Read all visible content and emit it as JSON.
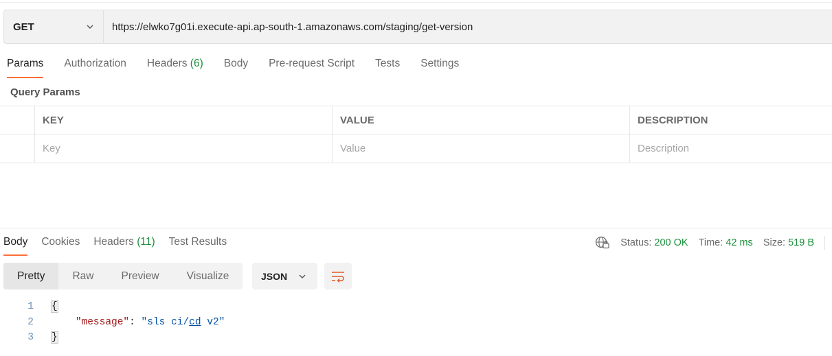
{
  "request": {
    "method": "GET",
    "url": "https://elwko7g01i.execute-api.ap-south-1.amazonaws.com/staging/get-version"
  },
  "request_tabs": [
    {
      "label": "Params",
      "count": ""
    },
    {
      "label": "Authorization",
      "count": ""
    },
    {
      "label": "Headers",
      "count": "(6)"
    },
    {
      "label": "Body",
      "count": ""
    },
    {
      "label": "Pre-request Script",
      "count": ""
    },
    {
      "label": "Tests",
      "count": ""
    },
    {
      "label": "Settings",
      "count": ""
    }
  ],
  "query_params": {
    "title": "Query Params",
    "columns": [
      "KEY",
      "VALUE",
      "DESCRIPTION"
    ],
    "placeholders": {
      "key": "Key",
      "value": "Value",
      "description": "Description"
    }
  },
  "response_tabs": [
    {
      "label": "Body",
      "count": ""
    },
    {
      "label": "Cookies",
      "count": ""
    },
    {
      "label": "Headers",
      "count": "(11)"
    },
    {
      "label": "Test Results",
      "count": ""
    }
  ],
  "status": {
    "status_label": "Status:",
    "status_value": "200 OK",
    "time_label": "Time:",
    "time_value": "42 ms",
    "size_label": "Size:",
    "size_value": "519 B"
  },
  "view_modes": [
    "Pretty",
    "Raw",
    "Preview",
    "Visualize"
  ],
  "format": "JSON",
  "code": {
    "line_numbers": [
      "1",
      "2",
      "3"
    ],
    "open_brace": "{",
    "close_brace": "}",
    "key": "\"message\"",
    "colon": ": ",
    "value_start": "\"sls ci/",
    "value_link": "cd",
    "value_end": " v2\""
  },
  "colors": {
    "accent": "#ff6c37",
    "status_green": "#1c8f3c"
  },
  "icons": [
    "chevron-down-icon",
    "globe-lock-icon",
    "wrap-lines-icon"
  ]
}
